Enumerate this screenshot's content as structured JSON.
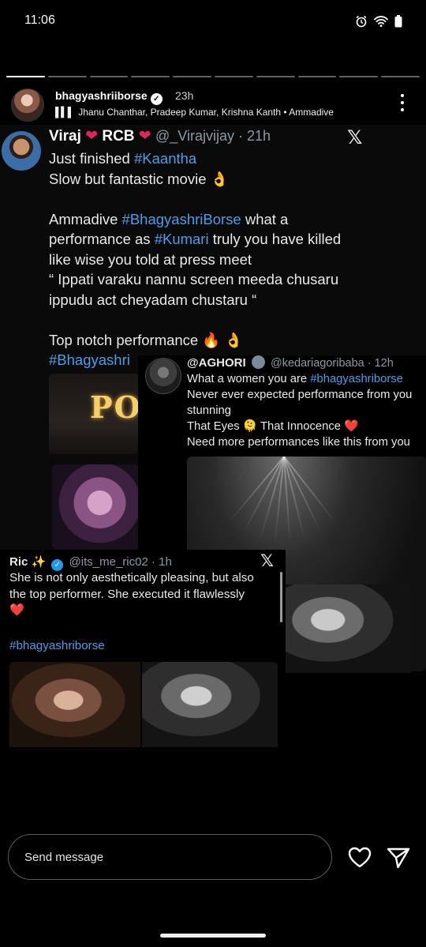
{
  "status_bar": {
    "time": "11:06",
    "icons": [
      "alarm-icon",
      "wifi-icon",
      "battery-icon"
    ]
  },
  "story": {
    "segments_total": 10,
    "segments_viewed": 1,
    "username": "bhagyashriiborse",
    "verified": true,
    "time_ago": "23h",
    "music_line": "Jhanu Chanthar, Pradeep Kumar, Krishna Kanth • Ammadive"
  },
  "tweet_main": {
    "name": "Viraj",
    "name_suffix": "RCB",
    "handle": "@_Virajvijay · 21h",
    "lines": [
      {
        "parts": [
          {
            "t": "Just finished "
          },
          {
            "t": "#Kaantha",
            "tag": true
          }
        ]
      },
      {
        "parts": [
          {
            "t": "Slow but fantastic movie 👌"
          }
        ]
      },
      {
        "parts": [
          {
            "t": " "
          }
        ]
      },
      {
        "parts": [
          {
            "t": "Ammadive "
          },
          {
            "t": "#BhagyashriBorse",
            "tag": true
          },
          {
            "t": " what a"
          }
        ]
      },
      {
        "parts": [
          {
            "t": "performance as "
          },
          {
            "t": "#Kumari",
            "tag": true
          },
          {
            "t": " truly you have killed"
          }
        ]
      },
      {
        "parts": [
          {
            "t": "like wise you told at press meet"
          }
        ]
      },
      {
        "parts": [
          {
            "t": "“ Ippati varaku nannu screen meeda chusaru"
          }
        ]
      },
      {
        "parts": [
          {
            "t": "ippudu act cheyadam chustaru “"
          }
        ]
      },
      {
        "parts": [
          {
            "t": " "
          }
        ]
      },
      {
        "parts": [
          {
            "t": "Top notch performance 🔥 👌"
          }
        ]
      },
      {
        "parts": [
          {
            "t": "#Bhagyashri",
            "tag": true
          }
        ]
      }
    ],
    "marquee_text": "PO"
  },
  "quote_card": {
    "name": "@AGHORI",
    "handle": "@kedariagoribaba · 12h",
    "lines": [
      {
        "parts": [
          {
            "t": "What a women you are "
          },
          {
            "t": "#bhagyashriborse",
            "tag": true
          }
        ]
      },
      {
        "parts": [
          {
            "t": "Never ever expected performance from you"
          }
        ]
      },
      {
        "parts": [
          {
            "t": "stunning"
          }
        ]
      },
      {
        "parts": [
          {
            "t": "That Eyes 🫠 That Innocence ❤️"
          }
        ]
      },
      {
        "parts": [
          {
            "t": "Need more performances like this from you"
          }
        ]
      }
    ]
  },
  "tweet_ric": {
    "name": "Ric ✨",
    "handle": "@its_me_ric02 · 1h",
    "text_lines": [
      "She is not only aesthetically pleasing, but also",
      "the top performer. She executed it flawlessly",
      "❤️"
    ],
    "hashtag": "#bhagyashriborse"
  },
  "bottom": {
    "placeholder": "Send message"
  },
  "colors": {
    "background": "#000000",
    "hashtag": "#4a9eea",
    "heart_red": "#e0245e",
    "x_verified_blue": "#1d9bf0",
    "handle_gray": "#8b98a5"
  }
}
